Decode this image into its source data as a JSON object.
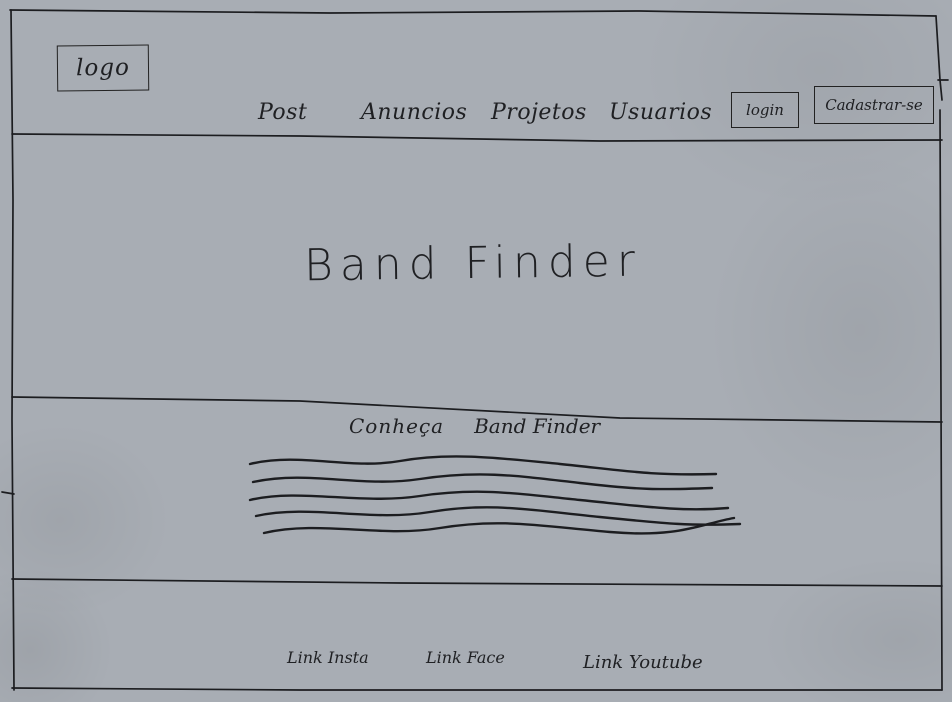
{
  "header": {
    "logo": "logo",
    "nav": [
      "Post",
      "Anuncios",
      "Projetos",
      "Usuarios"
    ],
    "login_label": "login",
    "signup_label": "Cadastrar-se"
  },
  "hero": {
    "title": "Band Finder"
  },
  "about": {
    "title_part1": "Conheça",
    "title_part2": "Band Finder"
  },
  "footer": {
    "links": [
      "Link Insta",
      "Link Face",
      "Link Youtube"
    ]
  }
}
